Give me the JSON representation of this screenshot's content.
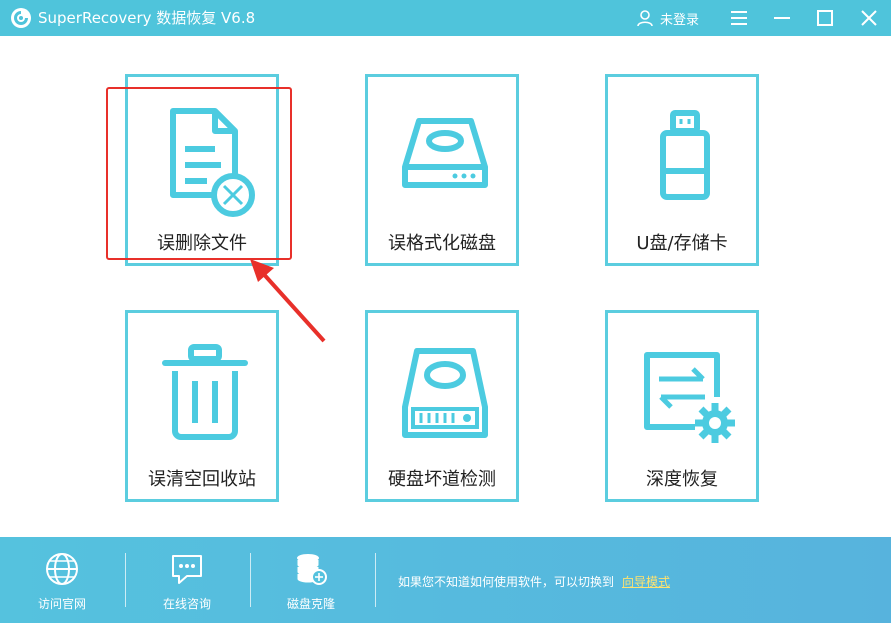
{
  "app": {
    "title": "SuperRecovery 数据恢复 V6.8",
    "user_label": "未登录"
  },
  "window_controls": [
    "menu-icon",
    "minimize-icon",
    "maximize-icon",
    "close-icon"
  ],
  "cards": [
    {
      "label": "误删除文件",
      "icon": "deleted-file-icon"
    },
    {
      "label": "误格式化磁盘",
      "icon": "format-disk-icon"
    },
    {
      "label": "U盘/存储卡",
      "icon": "usb-drive-icon"
    },
    {
      "label": "误清空回收站",
      "icon": "recycle-bin-icon"
    },
    {
      "label": "硬盘坏道检测",
      "icon": "hard-disk-check-icon"
    },
    {
      "label": "深度恢复",
      "icon": "deep-recovery-icon"
    }
  ],
  "bottom": {
    "items": [
      {
        "label": "访问官网",
        "icon": "globe-icon"
      },
      {
        "label": "在线咨询",
        "icon": "chat-icon"
      },
      {
        "label": "磁盘克隆",
        "icon": "disk-clone-icon"
      }
    ],
    "hint_text": "如果您不知道如何使用软件，可以切换到",
    "guide_link": "向导模式"
  },
  "colors": {
    "titlebar": "#4fc4db",
    "card_border": "#5bcddf",
    "highlight": "#e8302a",
    "guide_link": "#ffe36e"
  }
}
